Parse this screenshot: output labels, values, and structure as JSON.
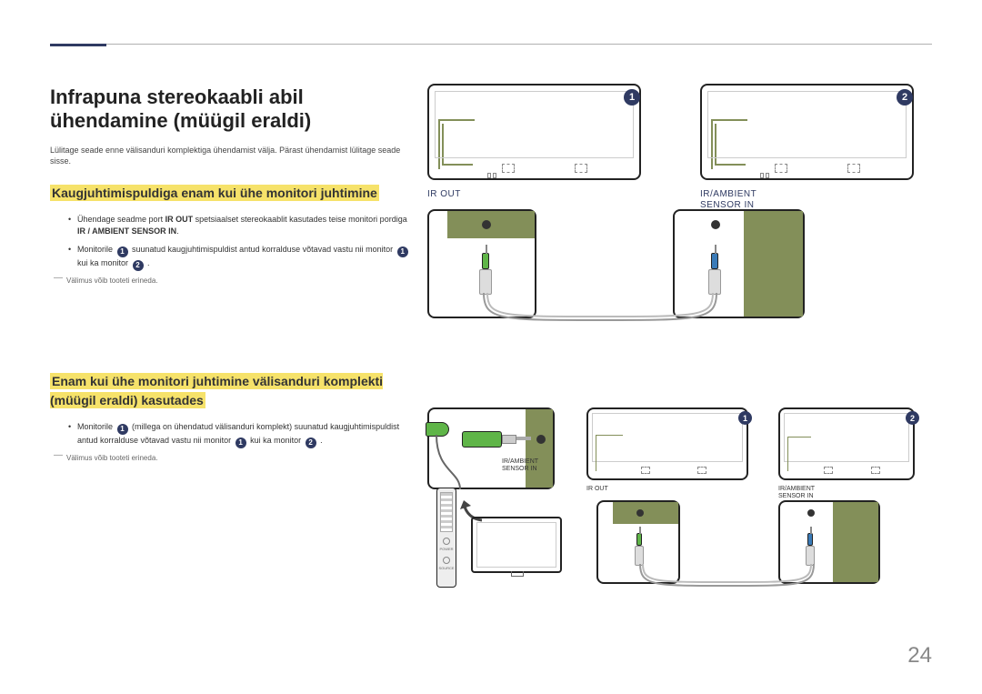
{
  "page_number": "24",
  "title": "Infrapuna stereokaabli abil ühendamine (müügil eraldi)",
  "intro": "Lülitage seade enne välisanduri komplektiga ühendamist välja. Pärast ühendamist lülitage seade sisse.",
  "section1": {
    "heading": "Kaugjuhtimispuldiga enam kui ühe monitori juhtimine",
    "bullets": [
      {
        "pre": "Ühendage seadme port ",
        "bold1": "IR OUT",
        "mid": " spetsiaalset stereokaablit kasutades teise monitori pordiga ",
        "bold2": "IR / AMBIENT SENSOR IN",
        "post": "."
      },
      {
        "pre": "Monitorile ",
        "n1": "1",
        "mid1": " suunatud kaugjuhtimispuldist antud korralduse võtavad vastu nii monitor ",
        "n2": "1",
        "mid2": " kui ka monitor ",
        "n3": "2",
        "post": " ."
      }
    ],
    "note": "Välimus võib tooteti erineda."
  },
  "section2": {
    "heading": "Enam kui ühe monitori juhtimine välisanduri komplekti (müügil eraldi) kasutades",
    "bullets": [
      {
        "pre": "Monitorile ",
        "n1": "1",
        "mid1": " (millega on ühendatud välisanduri komplekt) suunatud kaugjuhtimispuldist antud korralduse võtavad vastu nii monitor ",
        "n2": "1",
        "mid2": " kui ka monitor ",
        "n3": "2",
        "post": " ."
      }
    ],
    "note": "Välimus võib tooteti erineda."
  },
  "labels": {
    "ir_out": "IR OUT",
    "ir_ambient_sensor_in": "IR/AMBIENT SENSOR IN",
    "ir_ambient_sensor_in_stacked_1": "IR/AMBIENT",
    "ir_ambient_sensor_in_stacked_2": "SENSOR IN",
    "remote_power": "POWER",
    "remote_source": "SOURCE",
    "badge1": "1",
    "badge2": "2"
  }
}
